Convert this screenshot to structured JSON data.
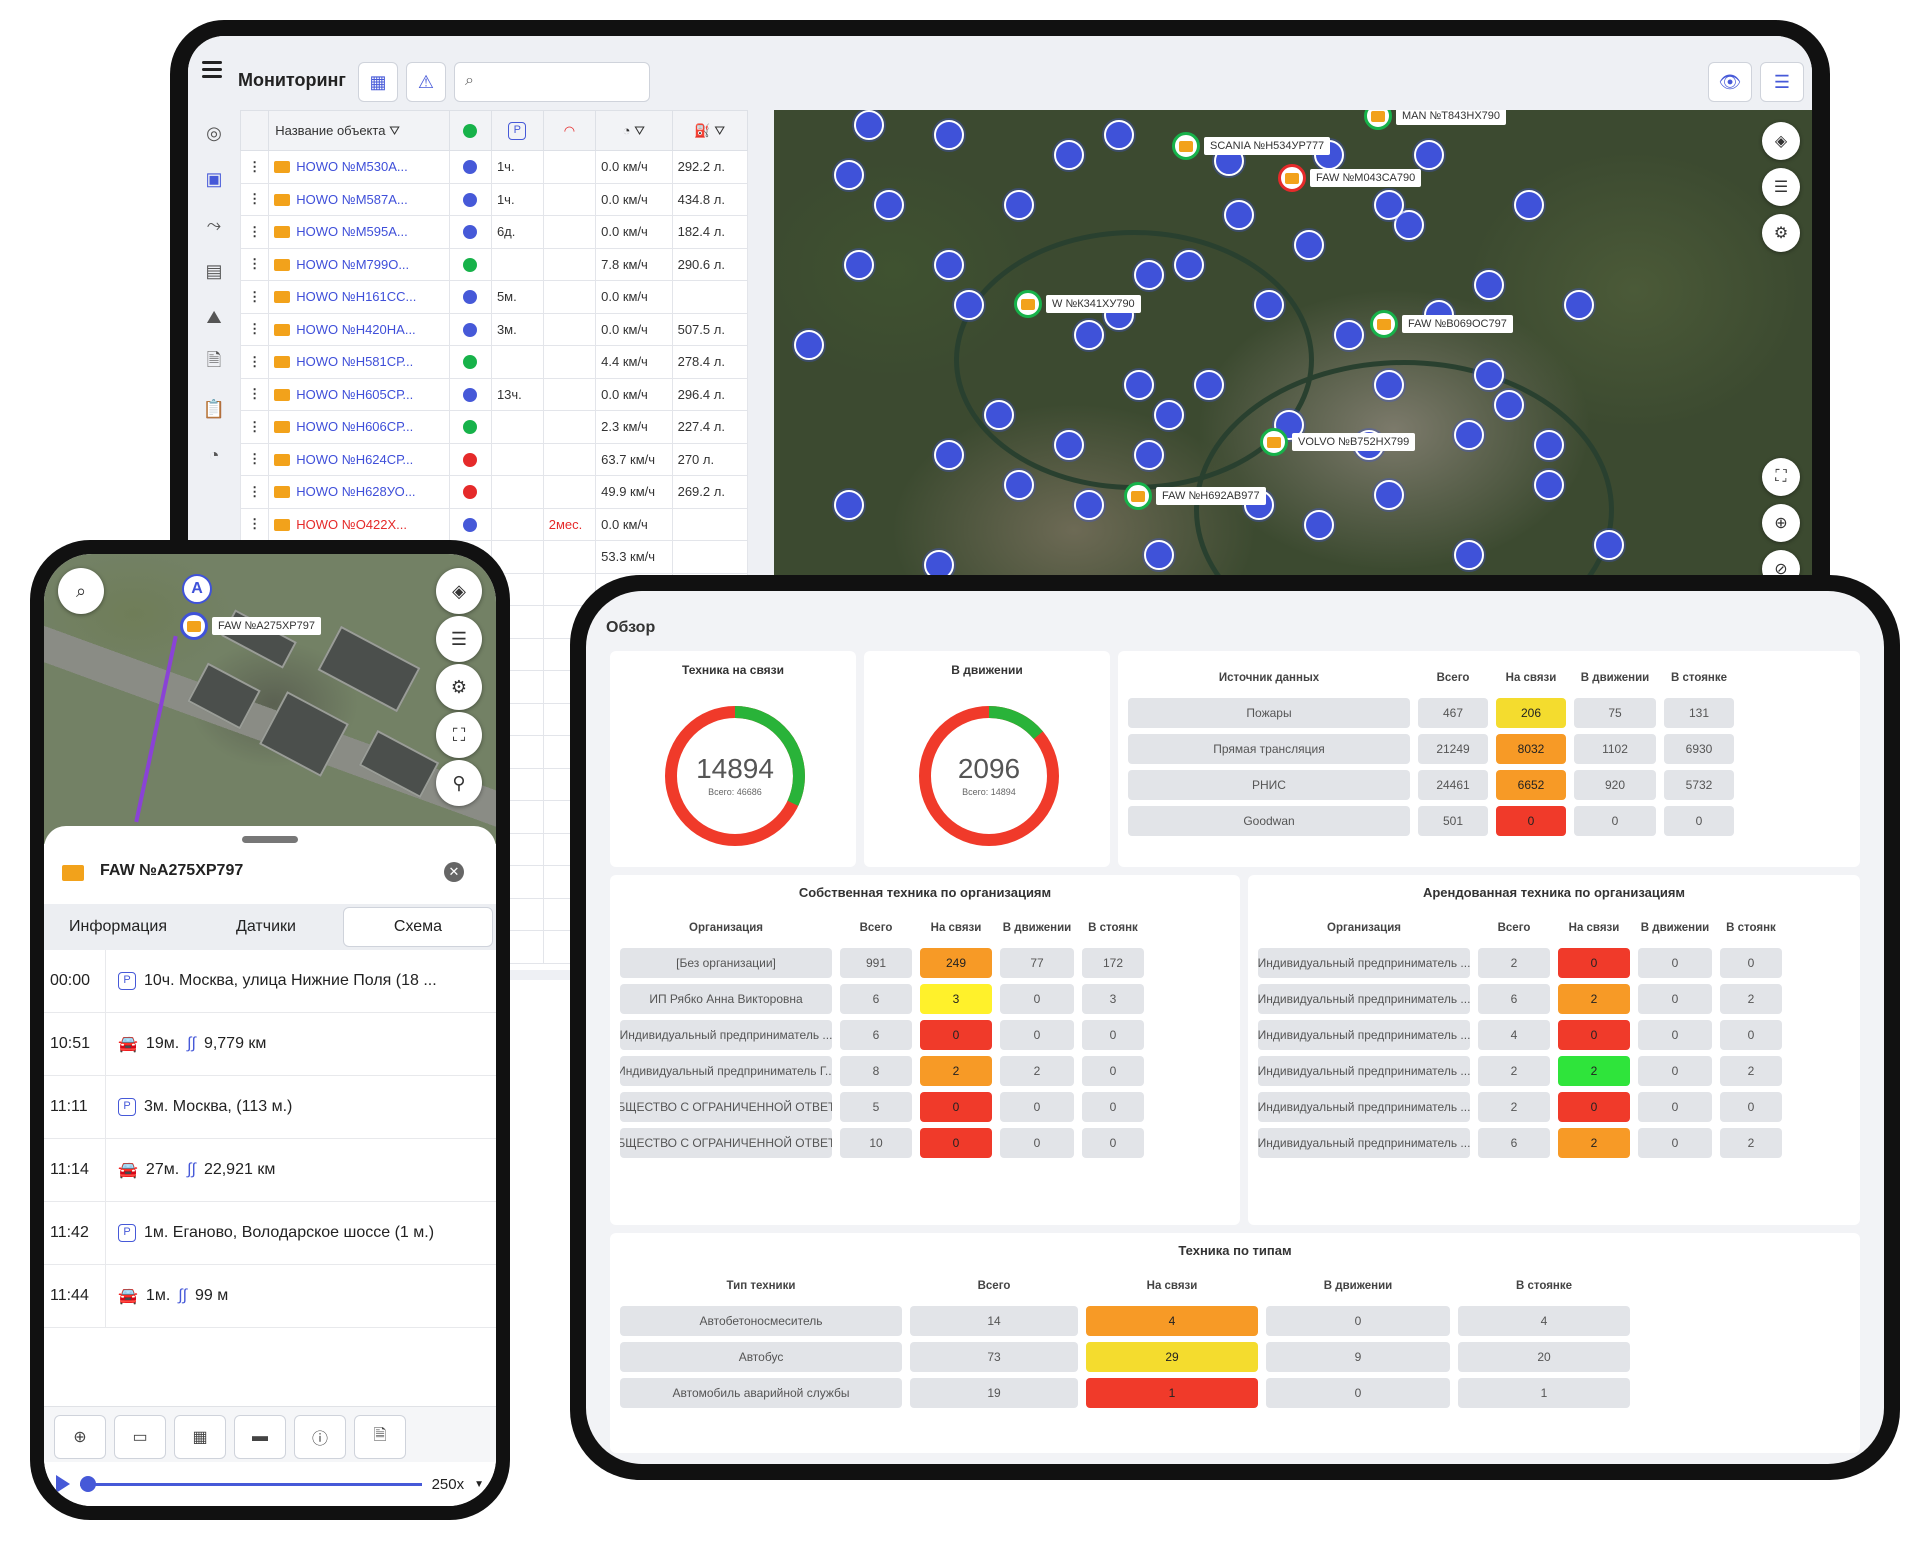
{
  "desktop": {
    "title": "Мониторинг",
    "search_placeholder": "",
    "table": {
      "header_name": "Название объекта",
      "rows": [
        {
          "name": "HOWO №М530А...",
          "status": "blue",
          "dur": "1ч.",
          "speed": "0.0 км/ч",
          "fuel": "292.2 л.",
          "alarm": false
        },
        {
          "name": "HOWO №М587А...",
          "status": "blue",
          "dur": "1ч.",
          "speed": "0.0 км/ч",
          "fuel": "434.8 л.",
          "alarm": false
        },
        {
          "name": "HOWO №М595А...",
          "status": "blue",
          "dur": "6д.",
          "speed": "0.0 км/ч",
          "fuel": "182.4 л.",
          "alarm": false
        },
        {
          "name": "HOWO №М799О...",
          "status": "green",
          "dur": "",
          "speed": "7.8 км/ч",
          "fuel": "290.6 л.",
          "alarm": false
        },
        {
          "name": "HOWO №Н161СС...",
          "status": "blue",
          "dur": "5м.",
          "speed": "0.0 км/ч",
          "fuel": "",
          "alarm": false
        },
        {
          "name": "HOWO №Н420НА...",
          "status": "blue",
          "dur": "3м.",
          "speed": "0.0 км/ч",
          "fuel": "507.5 л.",
          "alarm": false
        },
        {
          "name": "HOWO №Н581СР...",
          "status": "green",
          "dur": "",
          "speed": "4.4 км/ч",
          "fuel": "278.4 л.",
          "alarm": false
        },
        {
          "name": "HOWO №Н605СР...",
          "status": "blue",
          "dur": "13ч.",
          "speed": "0.0 км/ч",
          "fuel": "296.4 л.",
          "alarm": false
        },
        {
          "name": "HOWO №Н606СР...",
          "status": "green",
          "dur": "",
          "speed": "2.3 км/ч",
          "fuel": "227.4 л.",
          "alarm": false
        },
        {
          "name": "HOWO №Н624СР...",
          "status": "red",
          "dur": "",
          "speed": "63.7 км/ч",
          "fuel": "270 л.",
          "alarm": false
        },
        {
          "name": "HOWO №Н628УО...",
          "status": "red",
          "dur": "",
          "speed": "49.9 км/ч",
          "fuel": "269.2 л.",
          "alarm": false
        },
        {
          "name": "HOWO №О422Х...",
          "status": "blue",
          "dur": "2мес.",
          "speed": "0.0 км/ч",
          "fuel": "",
          "alarm": true
        },
        {
          "name": "",
          "status": "",
          "dur": "",
          "speed": "53.3 км/ч",
          "fuel": "",
          "alarm": false
        }
      ]
    },
    "map_labels": [
      "MAN №Т843НХ790",
      "SCANIA №Н534УР777",
      "FAW №М043СА790",
      "W №К341ХУ790",
      "FAW №В069ОС797",
      "VOLVO №В752НХ799",
      "FAW №Н692АВ977"
    ]
  },
  "phone": {
    "map_label": "FAW №А275ХР797",
    "sheet_title": "FAW №А275ХР797",
    "tabs": [
      "Информация",
      "Датчики",
      "Схема"
    ],
    "rows": [
      {
        "time": "00:00",
        "kind": "parking",
        "text": "10ч. Москва, улица Нижние Поля (18 ..."
      },
      {
        "time": "10:51",
        "kind": "move",
        "dur": "19м.",
        "dist": "9,779 км"
      },
      {
        "time": "11:11",
        "kind": "parking",
        "text": "3м. Москва, (113 м.)"
      },
      {
        "time": "11:14",
        "kind": "move",
        "dur": "27м.",
        "dist": "22,921 км"
      },
      {
        "time": "11:42",
        "kind": "parking",
        "text": "1м. Еганово, Володарское шоссе (1 м.)"
      },
      {
        "time": "11:44",
        "kind": "move",
        "dur": "1м.",
        "dist": "99 м"
      }
    ],
    "speed": "250x"
  },
  "tablet": {
    "title": "Обзор",
    "online": {
      "title": "Техника на связи",
      "value": "14894",
      "sub": "Всего: 46686",
      "fraction": 0.32
    },
    "moving": {
      "title": "В движении",
      "value": "2096",
      "sub": "Всего: 14894",
      "fraction": 0.14
    },
    "sources": {
      "headers": [
        "Источник данных",
        "Всего",
        "На связи",
        "В движении",
        "В стоянке"
      ],
      "rows": [
        {
          "name": "Пожары",
          "total": "467",
          "online": "206",
          "moving": "75",
          "parked": "131",
          "color": "yellow"
        },
        {
          "name": "Прямая трансляция",
          "total": "21249",
          "online": "8032",
          "moving": "1102",
          "parked": "6930",
          "color": "orange"
        },
        {
          "name": "РНИС",
          "total": "24461",
          "online": "6652",
          "moving": "920",
          "parked": "5732",
          "color": "orange"
        },
        {
          "name": "Goodwan",
          "total": "501",
          "online": "0",
          "moving": "0",
          "parked": "0",
          "color": "red"
        }
      ]
    },
    "own": {
      "title": "Собственная техника по организациям",
      "headers": [
        "Организация",
        "Всего",
        "На связи",
        "В движении",
        "В стоянк"
      ],
      "rows": [
        {
          "name": "[Без организации]",
          "total": "991",
          "online": "249",
          "moving": "77",
          "parked": "172",
          "color": "orange"
        },
        {
          "name": "ИП Рябко Анна Викторовна",
          "total": "6",
          "online": "3",
          "moving": "0",
          "parked": "3",
          "color": "yellow2"
        },
        {
          "name": "Индивидуальный предприниматель ...",
          "total": "6",
          "online": "0",
          "moving": "0",
          "parked": "0",
          "color": "red"
        },
        {
          "name": "Индивидуальный предприниматель Г...",
          "total": "8",
          "online": "2",
          "moving": "2",
          "parked": "0",
          "color": "orange"
        },
        {
          "name": "ОБЩЕСТВО С ОГРАНИЧЕННОЙ ОТВЕТ...",
          "total": "5",
          "online": "0",
          "moving": "0",
          "parked": "0",
          "color": "red"
        },
        {
          "name": "ОБЩЕСТВО С ОГРАНИЧЕННОЙ ОТВЕТ...",
          "total": "10",
          "online": "0",
          "moving": "0",
          "parked": "0",
          "color": "red"
        }
      ]
    },
    "rented": {
      "title": "Арендованная техника по организациям",
      "headers": [
        "Организация",
        "Всего",
        "На связи",
        "В движении",
        "В стоянк"
      ],
      "rows": [
        {
          "name": "Индивидуальный предприниматель ...",
          "total": "2",
          "online": "0",
          "moving": "0",
          "parked": "0",
          "color": "red"
        },
        {
          "name": "Индивидуальный предприниматель ...",
          "total": "6",
          "online": "2",
          "moving": "0",
          "parked": "2",
          "color": "orange"
        },
        {
          "name": "Индивидуальный предприниматель ...",
          "total": "4",
          "online": "0",
          "moving": "0",
          "parked": "0",
          "color": "red"
        },
        {
          "name": "Индивидуальный предприниматель ...",
          "total": "2",
          "online": "2",
          "moving": "0",
          "parked": "2",
          "color": "green"
        },
        {
          "name": "Индивидуальный предприниматель ...",
          "total": "2",
          "online": "0",
          "moving": "0",
          "parked": "0",
          "color": "red"
        },
        {
          "name": "Индивидуальный предприниматель ...",
          "total": "6",
          "online": "2",
          "moving": "0",
          "parked": "2",
          "color": "orange"
        }
      ]
    },
    "types": {
      "title": "Техника по типам",
      "headers": [
        "Тип техники",
        "Всего",
        "На связи",
        "В движении",
        "В стоянке"
      ],
      "rows": [
        {
          "name": "Автобетоносмеситель",
          "total": "14",
          "online": "4",
          "moving": "0",
          "parked": "4",
          "color": "orange"
        },
        {
          "name": "Автобус",
          "total": "73",
          "online": "29",
          "moving": "9",
          "parked": "20",
          "color": "yellow"
        },
        {
          "name": "Автомобиль аварийной службы",
          "total": "19",
          "online": "1",
          "moving": "0",
          "parked": "1",
          "color": "red"
        }
      ]
    }
  }
}
